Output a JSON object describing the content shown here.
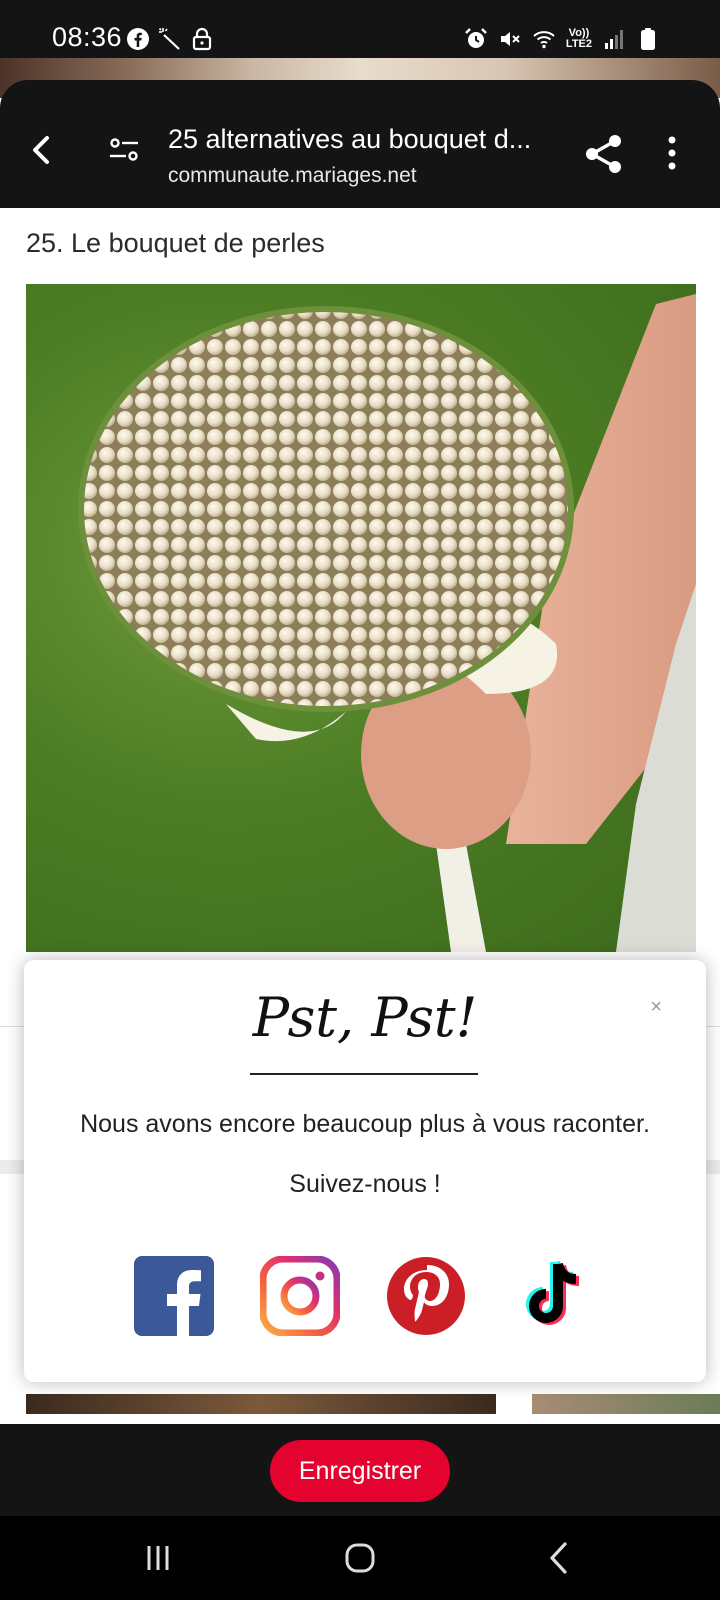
{
  "status_bar": {
    "time": "08:36",
    "left_icons": [
      "facebook-icon",
      "magic-wand-icon",
      "lock-icon"
    ],
    "right_icons": [
      "alarm-icon",
      "mute-icon",
      "wifi-icon",
      "volte-icon",
      "signal-icon",
      "battery-icon"
    ],
    "volte_line1": "Vo))",
    "volte_line2": "LTE2"
  },
  "toolbar": {
    "page_title": "25 alternatives au bouquet d...",
    "url": "communaute.mariages.net",
    "icons": [
      "back-arrow-icon",
      "page-settings-icon",
      "share-icon",
      "more-vertical-icon"
    ]
  },
  "content": {
    "item_heading": "25. Le bouquet de perles"
  },
  "popup": {
    "title": "Pst, Pst!",
    "close_label": "×",
    "message": "Nous avons encore beaucoup plus à vous raconter.",
    "follow_label": "Suivez-nous !",
    "social_links": [
      "facebook-icon",
      "instagram-icon",
      "pinterest-icon",
      "tiktok-icon"
    ]
  },
  "bottom_bar": {
    "save_label": "Enregistrer",
    "save_color": "#e4032e"
  },
  "nav_bar": {
    "buttons": [
      "recents-icon",
      "home-icon",
      "back-icon"
    ]
  }
}
